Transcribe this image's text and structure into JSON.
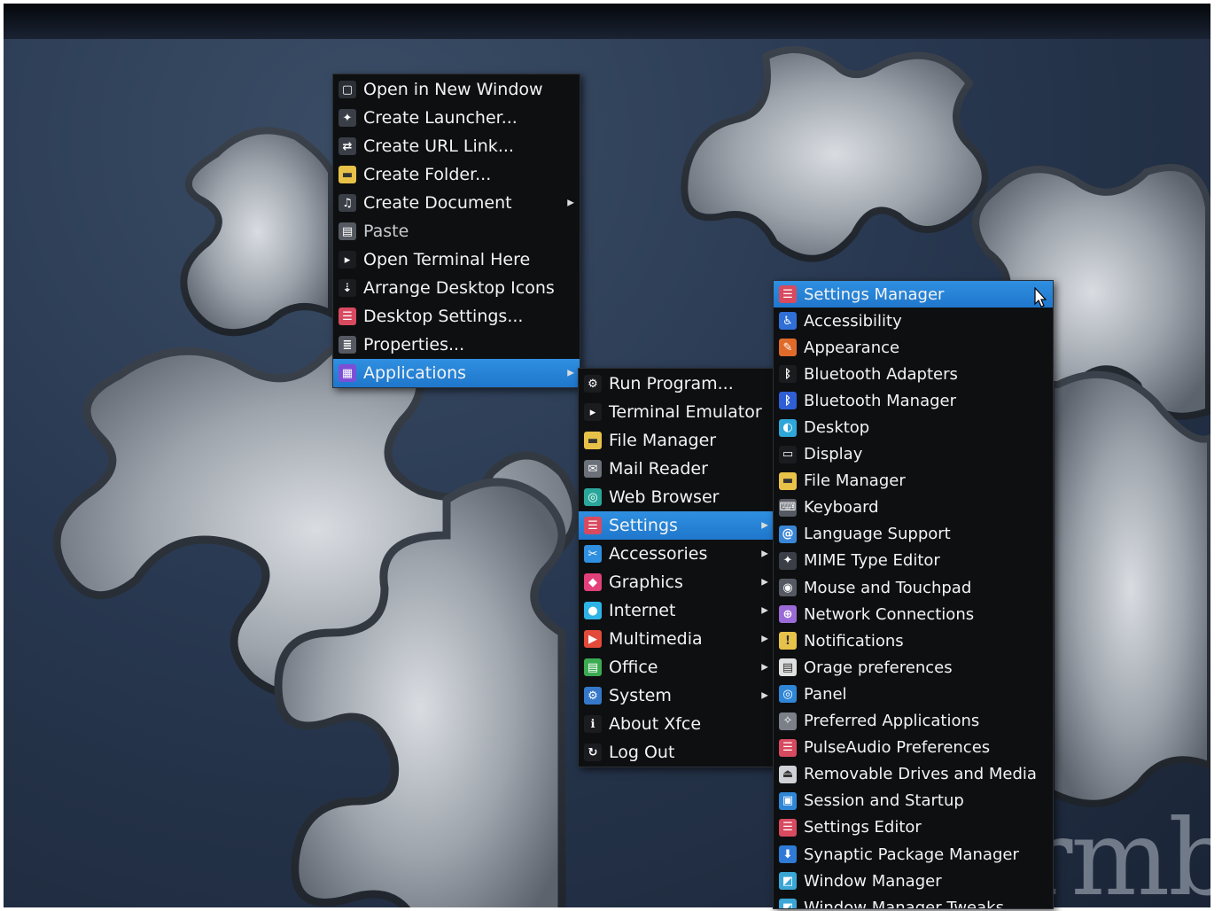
{
  "desktop_menu": {
    "items": [
      {
        "label": "Open in New Window",
        "icon": "window-icon"
      },
      {
        "label": "Create Launcher...",
        "icon": "launcher-icon"
      },
      {
        "label": "Create URL Link...",
        "icon": "link-icon"
      },
      {
        "label": "Create Folder...",
        "icon": "folder-icon"
      },
      {
        "label": "Create Document",
        "icon": "document-icon",
        "submenu": true
      },
      {
        "label": "Paste",
        "icon": "paste-icon"
      },
      {
        "label": "Open Terminal Here",
        "icon": "terminal-icon"
      },
      {
        "label": "Arrange Desktop Icons",
        "icon": "arrange-icon"
      },
      {
        "label": "Desktop Settings...",
        "icon": "settings-icon"
      },
      {
        "label": "Properties...",
        "icon": "properties-icon"
      },
      {
        "label": "Applications",
        "icon": "applications-icon",
        "submenu": true,
        "selected": true
      }
    ]
  },
  "applications_menu": {
    "items": [
      {
        "label": "Run Program...",
        "icon": "gear-icon"
      },
      {
        "label": "Terminal Emulator",
        "icon": "terminal-icon"
      },
      {
        "label": "File Manager",
        "icon": "folder-icon"
      },
      {
        "label": "Mail Reader",
        "icon": "mail-icon"
      },
      {
        "label": "Web Browser",
        "icon": "globe-icon"
      },
      {
        "label": "Settings",
        "icon": "settings-icon",
        "submenu": true,
        "selected": true
      },
      {
        "label": "Accessories",
        "icon": "accessories-icon",
        "submenu": true
      },
      {
        "label": "Graphics",
        "icon": "graphics-icon",
        "submenu": true
      },
      {
        "label": "Internet",
        "icon": "internet-icon",
        "submenu": true
      },
      {
        "label": "Multimedia",
        "icon": "multimedia-icon",
        "submenu": true
      },
      {
        "label": "Office",
        "icon": "office-icon",
        "submenu": true
      },
      {
        "label": "System",
        "icon": "system-icon",
        "submenu": true
      },
      {
        "label": "About Xfce",
        "icon": "info-icon"
      },
      {
        "label": "Log Out",
        "icon": "logout-icon"
      }
    ]
  },
  "settings_menu": {
    "items": [
      {
        "label": "Settings Manager",
        "icon": "settings-manager-icon",
        "selected": true
      },
      {
        "label": "Accessibility",
        "icon": "accessibility-icon"
      },
      {
        "label": "Appearance",
        "icon": "appearance-icon"
      },
      {
        "label": "Bluetooth Adapters",
        "icon": "bluetooth-adapter-icon"
      },
      {
        "label": "Bluetooth Manager",
        "icon": "bluetooth-icon"
      },
      {
        "label": "Desktop",
        "icon": "desktop-icon"
      },
      {
        "label": "Display",
        "icon": "display-icon"
      },
      {
        "label": "File Manager",
        "icon": "folder-icon"
      },
      {
        "label": "Keyboard",
        "icon": "keyboard-icon"
      },
      {
        "label": "Language Support",
        "icon": "language-icon"
      },
      {
        "label": "MIME Type Editor",
        "icon": "mime-icon"
      },
      {
        "label": "Mouse and Touchpad",
        "icon": "mouse-icon"
      },
      {
        "label": "Network Connections",
        "icon": "network-icon"
      },
      {
        "label": "Notifications",
        "icon": "notifications-icon"
      },
      {
        "label": "Orage preferences",
        "icon": "calendar-icon"
      },
      {
        "label": "Panel",
        "icon": "panel-icon"
      },
      {
        "label": "Preferred Applications",
        "icon": "preferred-apps-icon"
      },
      {
        "label": "PulseAudio Preferences",
        "icon": "pulseaudio-icon"
      },
      {
        "label": "Removable Drives and Media",
        "icon": "removable-drive-icon"
      },
      {
        "label": "Session and Startup",
        "icon": "session-icon"
      },
      {
        "label": "Settings Editor",
        "icon": "settings-editor-icon"
      },
      {
        "label": "Synaptic Package Manager",
        "icon": "package-icon"
      },
      {
        "label": "Window Manager",
        "icon": "window-manager-icon"
      },
      {
        "label": "Window Manager Tweaks",
        "icon": "window-manager-tweaks-icon"
      }
    ]
  },
  "wallpaper": {
    "brand_text": "rmb"
  },
  "colors": {
    "selection": "#2384d6",
    "menu_bg": "#0e0f11",
    "menu_text": "#f1f3f5"
  }
}
